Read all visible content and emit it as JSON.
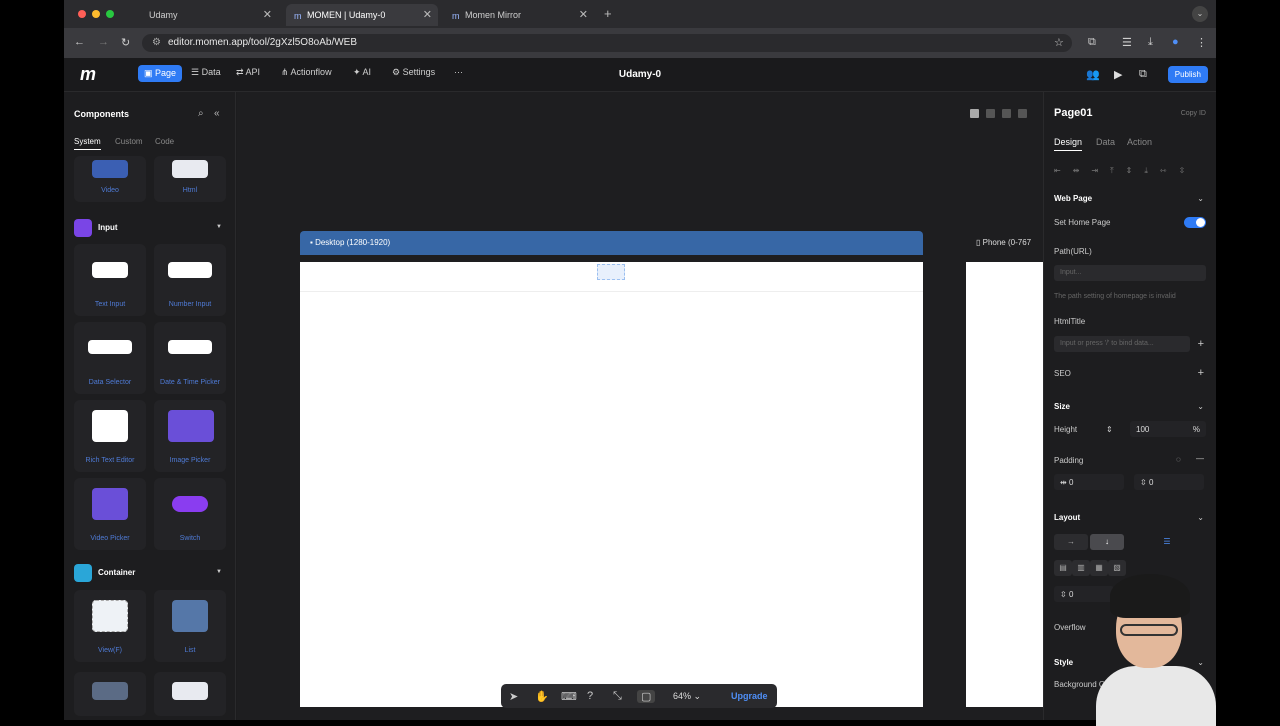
{
  "browser": {
    "tabs": [
      {
        "label": "Udamy"
      },
      {
        "label": "MOMEN | Udamy-0"
      },
      {
        "label": "Momen Mirror"
      }
    ],
    "url": "editor.momen.app/tool/2gXzl5O8oAb/WEB"
  },
  "appbar": {
    "menu": [
      {
        "label": "Page"
      },
      {
        "label": "Data"
      },
      {
        "label": "API"
      },
      {
        "label": "Actionflow"
      },
      {
        "label": "AI"
      },
      {
        "label": "Settings"
      }
    ],
    "more": "···",
    "title": "Udamy-0",
    "publish": "Publish"
  },
  "left_panel": {
    "title": "Components",
    "tabs": [
      {
        "label": "System"
      },
      {
        "label": "Custom"
      },
      {
        "label": "Code"
      }
    ],
    "top_items": [
      {
        "label": "Video"
      },
      {
        "label": "Html"
      }
    ],
    "categories": [
      {
        "label": "Input",
        "items": [
          {
            "label": "Text Input"
          },
          {
            "label": "Number Input"
          },
          {
            "label": "Data Selector"
          },
          {
            "label": "Date & Time Picker"
          },
          {
            "label": "Rich Text Editor"
          },
          {
            "label": "Image Picker"
          },
          {
            "label": "Video Picker"
          },
          {
            "label": "Switch"
          }
        ]
      },
      {
        "label": "Container",
        "items": [
          {
            "label": "View(F)"
          },
          {
            "label": "List"
          }
        ]
      }
    ],
    "colors": {
      "input": "#7a45e6",
      "container": "#2aa6d8"
    }
  },
  "canvas": {
    "desktop_label": "Desktop (1280-1920)",
    "phone_label": "Phone (0-767",
    "zoom": "64%",
    "upgrade": "Upgrade"
  },
  "right_panel": {
    "title": "Page01",
    "copy_id": "Copy ID",
    "tabs": [
      {
        "label": "Design"
      },
      {
        "label": "Data"
      },
      {
        "label": "Action"
      }
    ],
    "web_page": {
      "heading": "Web Page",
      "set_home": "Set Home Page",
      "set_home_on": true,
      "path_label": "Path(URL)",
      "path_placeholder": "Input...",
      "path_hint": "The path setting of homepage is invalid",
      "html_title_label": "HtmlTitle",
      "html_title_placeholder": "Input or press '/' to bind data...",
      "seo": "SEO"
    },
    "size": {
      "heading": "Size",
      "height_label": "Height",
      "height_value": "100",
      "height_unit": "%",
      "padding_label": "Padding",
      "padding_left": "0",
      "padding_top": "0"
    },
    "layout": {
      "heading": "Layout",
      "gap": "0",
      "overflow": "Overflow"
    },
    "style": {
      "heading": "Style",
      "background": "Background Co"
    }
  },
  "accent": "#2f7bf5"
}
